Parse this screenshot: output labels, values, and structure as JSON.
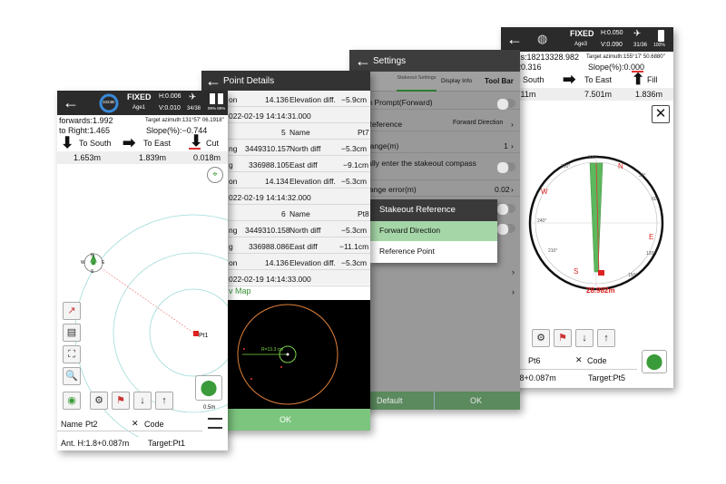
{
  "screen4": {
    "status": {
      "fixed": "FIXED",
      "h": "H:0.050",
      "v": "V:0.090",
      "age": "Age3",
      "sats": "31/36",
      "battery": "100%"
    },
    "line1": "wards:18213328.982",
    "target_azimuth": "Target azimuth:155°17′ 50.6880″",
    "line2": "ght:20.316",
    "slope": "Slope(%):0.000",
    "guidance": [
      {
        "arrow": "",
        "label": "",
        "value": "14.711m"
      },
      {
        "arrow": "➡",
        "label": "To East",
        "value": "7.501m"
      },
      {
        "arrow": "⬆",
        "label": "Fill",
        "value": "1.836m"
      }
    ],
    "south_label": "To South",
    "compass": {
      "n": "N",
      "e": "E",
      "s": "S",
      "w": "W",
      "t330": "330°",
      "t300": "300°",
      "t240": "240°",
      "t210": "210°",
      "t30": "30°",
      "t60": "60°",
      "t120": "120°",
      "t150": "150°",
      "distance": "28.982m"
    },
    "name_value": "Pt6",
    "code_label": "Code",
    "ant": "H:1.8+0.087m",
    "target": "Target:Pt5"
  },
  "screen3": {
    "title": "Settings",
    "tabs": [
      "ings",
      "Stakeout Settings",
      "Display Info",
      "Tool Bar"
    ],
    "items": [
      {
        "label": "igation Prompt(Forward)",
        "value": ""
      },
      {
        "label": "eout Reference",
        "value": "Forward Direction"
      },
      {
        "label": "mpt Range(m)",
        "value": "1"
      },
      {
        "label": "matically enter the stakeout compass",
        "value": ""
      },
      {
        "label": "eout range error(m)",
        "value": "0.02"
      }
    ],
    "default_label": "Default",
    "ok_label": "OK",
    "popup": {
      "title": "Stakeout Reference",
      "options": [
        "Forward Direction",
        "Reference Point"
      ]
    }
  },
  "screen2": {
    "title": "Point Details",
    "rows": [
      {
        "a": "on",
        "b": "14.136",
        "c": "Elevation diff.",
        "d": "−5.9cm"
      },
      {
        "a": "022-02-19 14:14:31.000",
        "b": "",
        "c": "",
        "d": ""
      },
      {
        "a": "",
        "b": "5",
        "c": "Name",
        "d": "Pt7"
      },
      {
        "a": "ng",
        "b": "3449310.157",
        "c": "North diff",
        "d": "−5.3cm"
      },
      {
        "a": "g",
        "b": "336988.105",
        "c": "East diff",
        "d": "−9.1cm"
      },
      {
        "a": "on",
        "b": "14.134",
        "c": "Elevation diff.",
        "d": "−5.3cm"
      },
      {
        "a": "022-02-19 14:14:32.000",
        "b": "",
        "c": "",
        "d": ""
      },
      {
        "a": "",
        "b": "6",
        "c": "Name",
        "d": "Pt8"
      },
      {
        "a": "ng",
        "b": "3449310.158",
        "c": "North diff",
        "d": "−5.3cm"
      },
      {
        "a": "g",
        "b": "336988.086",
        "c": "East diff",
        "d": "−11.1cm"
      },
      {
        "a": "on",
        "b": "14.136",
        "c": "Elevation diff.",
        "d": "−5.3cm"
      },
      {
        "a": "022-02-19 14:14:33.000",
        "b": "",
        "c": "",
        "d": ""
      }
    ],
    "map_link": "v Map",
    "radius_label": "R=13.3 cm",
    "ok_label": "OK"
  },
  "screen1": {
    "status": {
      "fixed": "FIXED",
      "h": "H:0.006",
      "v": "V:0.010",
      "age": "Age1",
      "sats": "34/38",
      "battery": "99% 89%",
      "gauge": "1024B"
    },
    "forwards": "forwards:1.992",
    "target_azimuth": "Target azimuth:131°57′ 06.1918″",
    "right": "to Right:1.465",
    "slope": "Slope(%):−0.744",
    "guidance": [
      {
        "arrow": "⬇",
        "label": "To South",
        "value": "1.653m"
      },
      {
        "arrow": "➡",
        "label": "To East",
        "value": "1.839m"
      },
      {
        "arrow": "⬇",
        "label": "Cut",
        "value": "0.018m"
      }
    ],
    "point_label": "Pt1",
    "scale": "0.5m",
    "name_label": "Name",
    "name_value": "Pt2",
    "code_label": "Code",
    "ant": "Ant. H:1.8+0.087m",
    "target": "Target:Pt1",
    "mini_compass": {
      "n": "N",
      "e": "E",
      "s": "S",
      "w": "W"
    }
  }
}
